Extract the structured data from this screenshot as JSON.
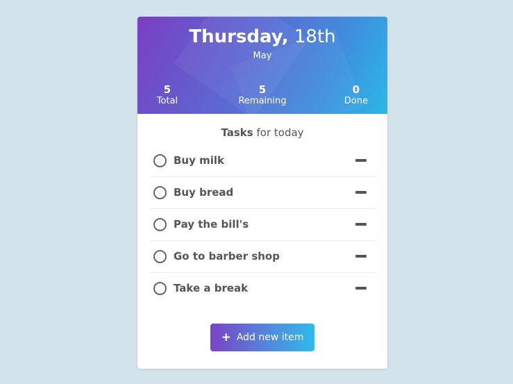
{
  "header": {
    "day_name": "Thursday,",
    "day_number": "18th",
    "month": "May",
    "stats": {
      "total": {
        "value": "5",
        "label": "Total"
      },
      "remaining": {
        "value": "5",
        "label": "Remaining"
      },
      "done": {
        "value": "0",
        "label": "Done"
      }
    }
  },
  "tasks": {
    "heading_bold": "Tasks",
    "heading_rest": " for today",
    "items": [
      {
        "label": "Buy milk"
      },
      {
        "label": "Buy bread"
      },
      {
        "label": "Pay the bill's"
      },
      {
        "label": "Go to barber shop"
      },
      {
        "label": "Take a break"
      }
    ]
  },
  "add_button": {
    "icon": "+",
    "label": "Add new item"
  },
  "colors": {
    "background": "#d3e3ec",
    "gradient_start": "#7a3fc4",
    "gradient_end": "#2ab8e8"
  }
}
